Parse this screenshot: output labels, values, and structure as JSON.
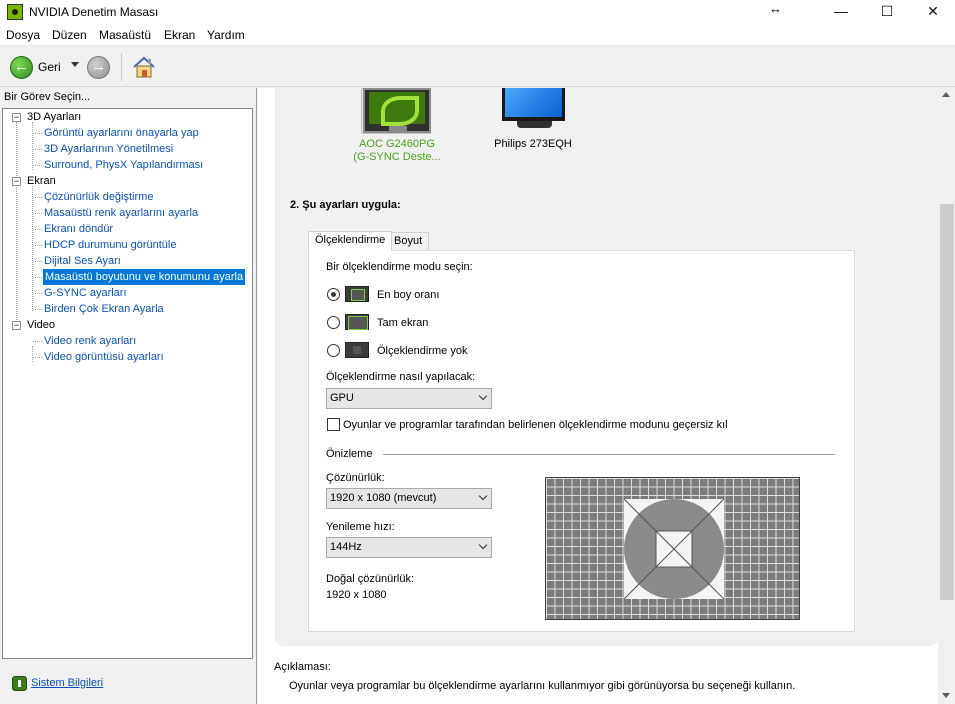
{
  "window": {
    "title": "NVIDIA Denetim Masası",
    "resize_glyph": "↔",
    "minimize": "—",
    "maximize": "☐",
    "close": "✕"
  },
  "menu": [
    "Dosya",
    "Düzen",
    "Masaüstü",
    "Ekran",
    "Yardım"
  ],
  "toolbar": {
    "back_label": "Geri",
    "back_icon": "back-arrow-icon",
    "forward_icon": "forward-arrow-icon",
    "home_icon": "home-icon"
  },
  "left": {
    "header": "Bir Görev Seçin...",
    "tree": [
      {
        "label": "3D Ayarları",
        "children": [
          "Görüntü ayarlarını önayarla yap",
          "3D Ayarlarının Yönetilmesi",
          "Surround, PhysX Yapılandırması"
        ]
      },
      {
        "label": "Ekran",
        "children": [
          "Çözünürlük değiştirme",
          "Masaüstü renk ayarlarını ayarla",
          "Ekranı döndür",
          "HDCP durumunu görüntüle",
          "Dijital Ses Ayarı",
          "Masaüstü boyutunu ve konumunu ayarla",
          "G-SYNC ayarları",
          "Birden Çok Ekran Ayarla"
        ]
      },
      {
        "label": "Video",
        "children": [
          "Video renk ayarları",
          "Video görüntüsü ayarları"
        ]
      }
    ],
    "selected": "Masaüstü boyutunu ve konumunu ayarla",
    "system_info": "Sistem Bilgileri"
  },
  "monitors": [
    {
      "name_line1": "AOC G2460PG",
      "name_line2": "(G-SYNC Deste...",
      "selected": true
    },
    {
      "name_line1": "Philips 273EQH",
      "name_line2": "",
      "selected": false
    }
  ],
  "step2": {
    "title": "2. Şu ayarları uygula:",
    "tabs": [
      "Ölçeklendirme",
      "Boyut"
    ],
    "active_tab": "Ölçeklendirme",
    "mode_label": "Bir ölçeklendirme modu seçin:",
    "modes": [
      {
        "label": "En boy oranı",
        "checked": true,
        "icon": "aspect-ratio-icon"
      },
      {
        "label": "Tam ekran",
        "checked": false,
        "icon": "fullscreen-icon"
      },
      {
        "label": "Ölçeklendirme yok",
        "checked": false,
        "icon": "no-scaling-icon"
      }
    ],
    "how_label": "Ölçeklendirme nasıl yapılacak:",
    "how_value": "GPU",
    "override_label": "Oyunlar ve programlar tarafından belirlenen ölçeklendirme modunu geçersiz kıl",
    "override_checked": false,
    "preview_label": "Önizleme",
    "resolution_label": "Çözünürlük:",
    "resolution_value": "1920 x 1080 (mevcut)",
    "refresh_label": "Yenileme hızı:",
    "refresh_value": "144Hz",
    "native_label": "Doğal çözünürlük:",
    "native_value": "1920 x 1080"
  },
  "description": {
    "title": "Açıklaması:",
    "text": "Oyunlar veya programlar bu ölçeklendirme ayarlarını kullanmıyor gibi görünüyorsa bu seçeneği kullanın."
  }
}
